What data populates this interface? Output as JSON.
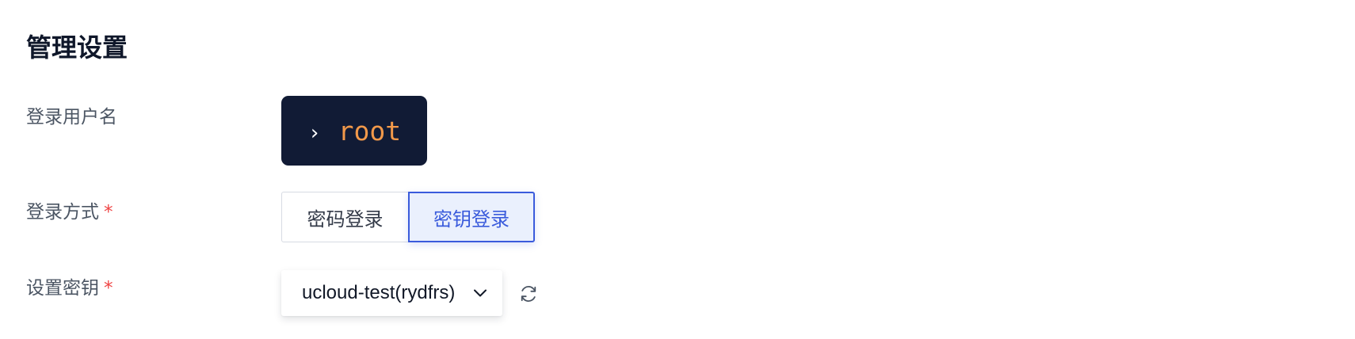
{
  "section": {
    "title": "管理设置"
  },
  "fields": {
    "username": {
      "label": "登录用户名",
      "prompt_symbol": "›",
      "value": "root"
    },
    "login_method": {
      "label": "登录方式",
      "required_mark": "*",
      "options": [
        "密码登录",
        "密钥登录"
      ],
      "selected": "密钥登录"
    },
    "key": {
      "label": "设置密钥",
      "required_mark": "*",
      "selected_value": "ucloud-test(rydfrs)",
      "dropdown_icon": "chevron-down-icon",
      "refresh_icon": "refresh-icon"
    }
  },
  "colors": {
    "title": "#0f172a",
    "label": "#4b5563",
    "required": "#ef4444",
    "terminal_bg": "#111b35",
    "terminal_user": "#f2994a",
    "accent": "#3a5bdc",
    "accent_bg": "#eaf0fd"
  }
}
